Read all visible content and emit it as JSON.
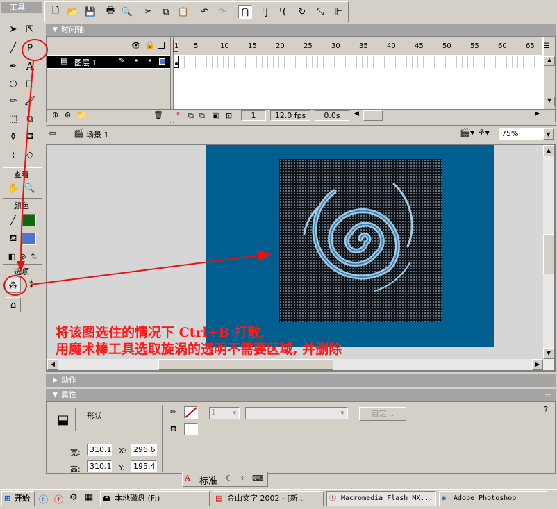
{
  "toolbox": {
    "title": "工具",
    "view_title": "查看",
    "colors_title": "颜色",
    "options_title": "选项",
    "colors": {
      "stroke": "#0a6b0a",
      "fill": "#4f74d6"
    }
  },
  "toolbar": {
    "icons": [
      "new-icon",
      "open-icon",
      "save-icon",
      "print-icon",
      "print-preview-icon",
      "cut-icon",
      "copy-icon",
      "paste-icon",
      "undo-icon",
      "redo-icon",
      "snap-magnet-icon",
      "smooth-icon",
      "straighten-icon",
      "rotate-icon",
      "scale-icon",
      "align-icon"
    ]
  },
  "timeline": {
    "title": "时间轴",
    "layer_name": "图层 1",
    "frame_numbers": [
      "1",
      "5",
      "10",
      "15",
      "20",
      "25",
      "30",
      "35",
      "40",
      "45",
      "50",
      "55",
      "60",
      "65"
    ],
    "current_frame": "1",
    "fps": "12.0 fps",
    "time": "0.0s"
  },
  "scene": {
    "label": "场景 1",
    "zoom": "75%"
  },
  "stage": {
    "stage_color": "#005f8f",
    "annotation_line1": "将该图选住的情况下 Ctrl+B 打散,",
    "annotation_line2": "用魔术棒工具选取旋涡的透明不需要区域, 并删除",
    "annotation_color": "#ff1a1a"
  },
  "panels": {
    "actions_title": "动作",
    "properties_title": "属性"
  },
  "properties": {
    "shape_label": "形状",
    "width_label": "宽:",
    "width_value": "310.1",
    "height_label": "高:",
    "height_value": "310.1",
    "x_label": "X:",
    "x_value": "296.6",
    "y_label": "Y:",
    "y_value": "195.4",
    "stroke_height": "1",
    "custom_button": "自定...",
    "text_panel_label": "标准"
  },
  "taskbar": {
    "start_label": "开始",
    "items": [
      {
        "label": "本地磁盘 (F:)"
      },
      {
        "label": "金山文字 2002 - [新..."
      },
      {
        "label": "Macromedia Flash MX..."
      },
      {
        "label": "Adobe Photoshop"
      }
    ]
  }
}
